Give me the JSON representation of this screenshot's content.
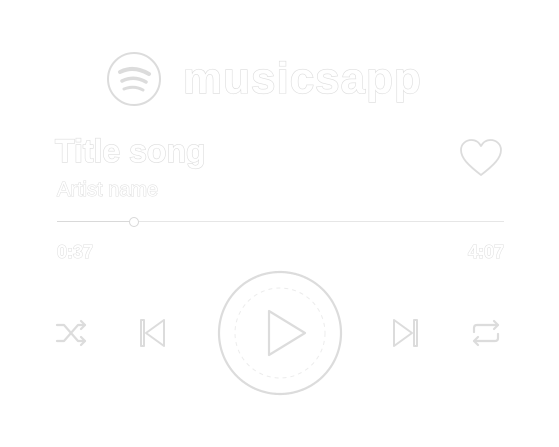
{
  "app": {
    "name": "musicsapp",
    "logo_icon": "spotify-logo-icon"
  },
  "track": {
    "title": "Title song",
    "artist": "Artist name",
    "liked": false
  },
  "progress": {
    "current": "0:37",
    "total": "4:07",
    "fraction": 0.17
  },
  "controls": {
    "shuffle_icon": "shuffle-icon",
    "previous_icon": "skip-previous-icon",
    "play_icon": "play-icon",
    "next_icon": "skip-next-icon",
    "repeat_icon": "repeat-icon"
  },
  "colors": {
    "foreground": "#ffffff",
    "outline": "#dcdcdc",
    "background": "#ffffff"
  }
}
